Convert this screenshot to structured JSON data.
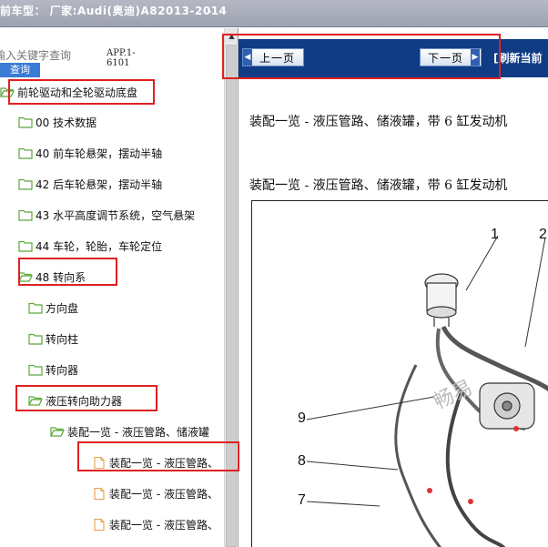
{
  "title_bar": {
    "text": "前车型：  厂家:Audi(奥迪)A82013-2014",
    "dot": "."
  },
  "search": {
    "placeholder": "输入关键字查询",
    "button_label": "查询",
    "app_code": "APP.1-6101"
  },
  "tree": {
    "root": "前轮驱动和全轮驱动底盘",
    "items": [
      {
        "label": "00 技术数据"
      },
      {
        "label": "40 前车轮悬架，摆动半轴"
      },
      {
        "label": "42 后车轮悬架，摆动半轴"
      },
      {
        "label": "43 水平高度调节系统，空气悬架"
      },
      {
        "label": "44 车轮，轮胎，车轮定位"
      },
      {
        "label": "48 转向系"
      }
    ],
    "steering_children": [
      {
        "label": "方向盘"
      },
      {
        "label": "转向柱"
      },
      {
        "label": "转向器"
      },
      {
        "label": "液压转向助力器"
      }
    ],
    "hydraulic_child": "装配一览 - 液压管路、储液罐",
    "docs": [
      {
        "label": "装配一览 - 液压管路、"
      },
      {
        "label": "装配一览 - 液压管路、"
      },
      {
        "label": "装配一览 - 液压管路、"
      }
    ]
  },
  "nav": {
    "prev_label": "上一页",
    "next_label": "下一页",
    "refresh_label": "[刷新当前"
  },
  "document": {
    "heading_1": "装配一览 - 液压管路、储液罐，带 6 缸发动机",
    "heading_2": "装配一览 - 液压管路、储液罐，带 6 缸发动机",
    "callouts": [
      "1",
      "2",
      "9",
      "8",
      "7"
    ],
    "watermark": "畅易"
  },
  "colors": {
    "highlight": "#e02020",
    "nav_bar": "#0f3c85",
    "folder": "#5aa83a",
    "doc_icon": "#e8a04a"
  }
}
